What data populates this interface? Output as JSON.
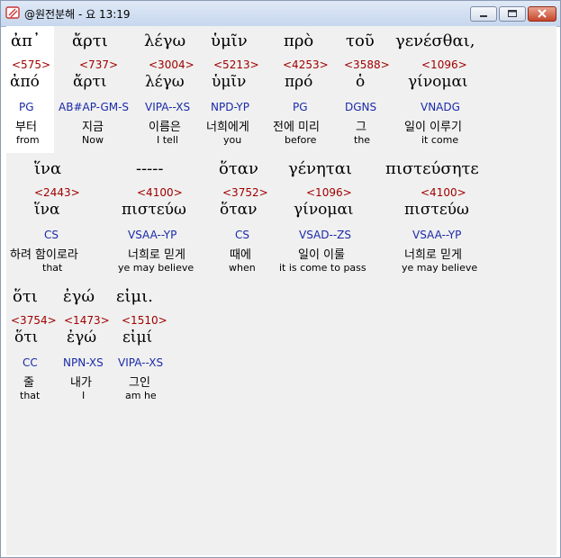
{
  "window": {
    "title": "@원전분해 - 요 13:19",
    "icon": "bible-app-icon",
    "controls": [
      "minimize-icon",
      "maximize-icon",
      "close-icon"
    ]
  },
  "colors": {
    "strongs": "#a00000",
    "parsing": "#1a2aa8",
    "background": "#f0f0f0",
    "highlight": "#ffffff"
  },
  "lines": [
    {
      "words": [
        {
          "greek": "ἀπ᾽",
          "strong": "<575>",
          "lemma": "ἀπό",
          "parse": "PG",
          "korean": "부터",
          "english": "from"
        },
        {
          "greek": "ἄρτι",
          "strong": "<737>",
          "lemma": "ἄρτι",
          "parse": "AB#AP-GM-S",
          "korean": "지금",
          "english": "Now"
        },
        {
          "greek": "λέγω",
          "strong": "<3004>",
          "lemma": "λέγω",
          "parse": "VIPA--XS",
          "korean": "이름은",
          "english": "I tell"
        },
        {
          "greek": "ὑμῖν",
          "strong": "<5213>",
          "lemma": "ὑμῖν",
          "parse": "NPD-YP",
          "korean": "너희에게",
          "english": "you"
        },
        {
          "greek": "πρὸ",
          "strong": "<4253>",
          "lemma": "πρό",
          "parse": "PG",
          "korean": "전에 미리",
          "english": "before"
        },
        {
          "greek": "τοῦ",
          "strong": "<3588>",
          "lemma": "ὁ",
          "parse": "DGNS",
          "korean": "그",
          "english": "the"
        },
        {
          "greek": "γενέσθαι,",
          "strong": "<1096>",
          "lemma": "γίνομαι",
          "parse": "VNADG",
          "korean": "일이 이루기",
          "english": "it come"
        }
      ]
    },
    {
      "words": [
        {
          "greek": "ἵνα",
          "strong": "<2443>",
          "lemma": "ἵνα",
          "parse": "CS",
          "korean": "하려 함이로라",
          "english": "that"
        },
        {
          "greek": "-----",
          "strong": "<4100>",
          "lemma": "πιστεύω",
          "parse": "VSAA--YP",
          "korean": "너희로 믿게",
          "english": "ye may believe"
        },
        {
          "greek": "ὅταν",
          "strong": "<3752>",
          "lemma": "ὅταν",
          "parse": "CS",
          "korean": "때에",
          "english": "when"
        },
        {
          "greek": "γένηται",
          "strong": "<1096>",
          "lemma": "γίνομαι",
          "parse": "VSAD--ZS",
          "korean": "일이 이룰",
          "english": "it is come to pass"
        },
        {
          "greek": "πιστεύσητε",
          "strong": "<4100>",
          "lemma": "πιστεύω",
          "parse": "VSAA--YP",
          "korean": "너희로 믿게",
          "english": "ye may believe"
        }
      ]
    },
    {
      "words": [
        {
          "greek": "ὅτι",
          "strong": "<3754>",
          "lemma": "ὅτι",
          "parse": "CC",
          "korean": "줄",
          "english": "that"
        },
        {
          "greek": "ἐγώ",
          "strong": "<1473>",
          "lemma": "ἐγώ",
          "parse": "NPN-XS",
          "korean": "내가",
          "english": "I"
        },
        {
          "greek": "εἰμι.",
          "strong": "<1510>",
          "lemma": "εἰμί",
          "parse": "VIPA--XS",
          "korean": "그인",
          "english": "am he"
        }
      ]
    }
  ]
}
